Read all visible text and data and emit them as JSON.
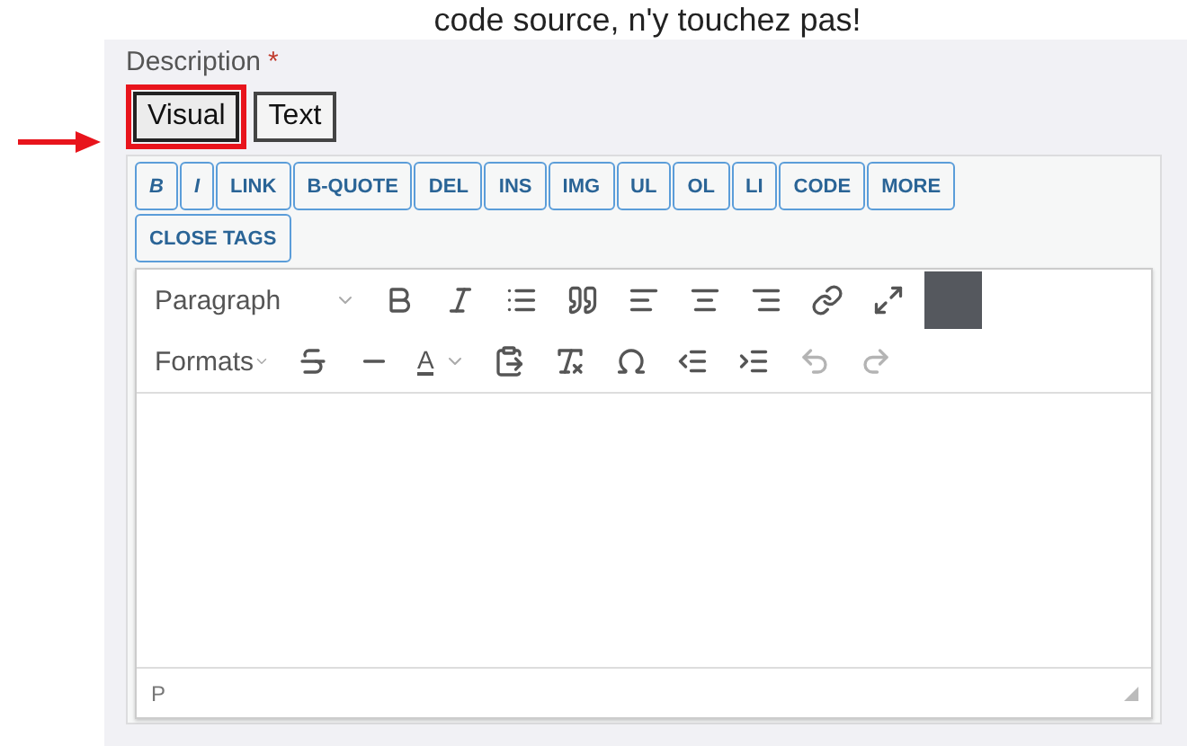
{
  "caption": "code source, n'y touchez pas!",
  "field": {
    "label": "Description",
    "required_mark": "*"
  },
  "tabs": [
    {
      "label": "Visual",
      "selected": true,
      "highlighted": true
    },
    {
      "label": "Text",
      "selected": false,
      "highlighted": false
    }
  ],
  "quicktags": [
    "B",
    "I",
    "LINK",
    "B-QUOTE",
    "DEL",
    "INS",
    "IMG",
    "UL",
    "OL",
    "LI",
    "CODE",
    "MORE",
    "CLOSE TAGS"
  ],
  "toolbar_rows": [
    [
      {
        "kind": "dropdown",
        "label": "Paragraph"
      },
      {
        "kind": "bold"
      },
      {
        "kind": "italic"
      },
      {
        "kind": "bullets"
      },
      {
        "kind": "quote"
      },
      {
        "kind": "align_left"
      },
      {
        "kind": "align_center"
      },
      {
        "kind": "align_right"
      },
      {
        "kind": "link"
      },
      {
        "kind": "fullscreen"
      },
      {
        "kind": "swatch",
        "color": "#55585e"
      }
    ],
    [
      {
        "kind": "dropdown",
        "label": "Formats"
      },
      {
        "kind": "strike"
      },
      {
        "kind": "hr"
      },
      {
        "kind": "text_color",
        "label": "A"
      },
      {
        "kind": "paste_text"
      },
      {
        "kind": "clear_format"
      },
      {
        "kind": "special_char"
      },
      {
        "kind": "outdent"
      },
      {
        "kind": "indent"
      },
      {
        "kind": "undo",
        "disabled": true
      },
      {
        "kind": "redo",
        "disabled": true
      }
    ]
  ],
  "status_path": "P"
}
